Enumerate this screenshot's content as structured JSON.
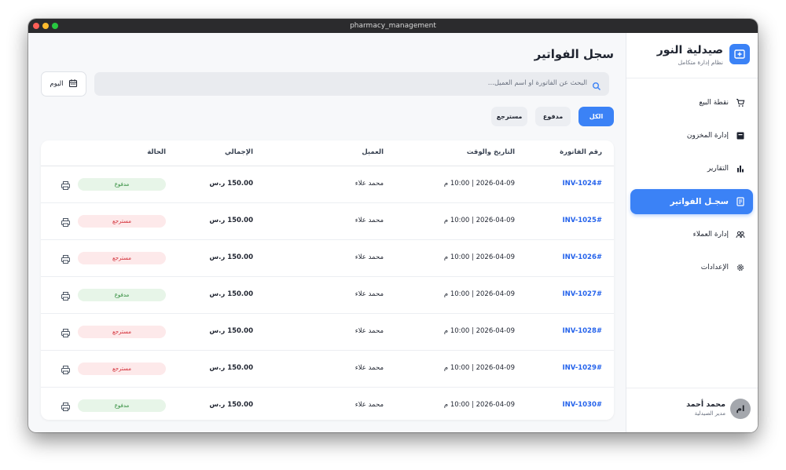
{
  "window": {
    "title": "pharmacy_management"
  },
  "brand": {
    "name": "صيدلية النور",
    "subtitle": "نظام إدارة متكامل"
  },
  "nav": [
    {
      "label": "نقطة البيع",
      "icon": "cart-icon"
    },
    {
      "label": "إدارة المخزون",
      "icon": "box-icon"
    },
    {
      "label": "التقارير",
      "icon": "bar-chart-icon"
    },
    {
      "label": "سجـل الفواتير",
      "icon": "receipt-icon",
      "active": true
    },
    {
      "label": "إدارة العملاء",
      "icon": "users-icon"
    },
    {
      "label": "الإعدادات",
      "icon": "gear-icon"
    }
  ],
  "user": {
    "initials": "ام",
    "name": "محمد أحمد",
    "role": "مدير الصيدلية"
  },
  "page": {
    "title": "سجل الفواتير"
  },
  "search": {
    "placeholder": "البحث عن الفاتورة او اسم العميل..."
  },
  "date_button": {
    "label": "اليوم"
  },
  "filters": [
    {
      "label": "الكل",
      "active": true
    },
    {
      "label": "مدفوع"
    },
    {
      "label": "مسترجع"
    }
  ],
  "table": {
    "headers": {
      "invoice": "رقم الفاتورة",
      "datetime": "التاريخ والوقت",
      "customer": "العميل",
      "total": "الإجمالي",
      "status": "الحالة"
    },
    "rows": [
      {
        "invoice": "INV-1024#",
        "datetime": "2026-04-09 | 10:00 م",
        "customer": "محمد علاء",
        "total": "150.00 ر.س",
        "status": "مدفوع",
        "status_type": "paid"
      },
      {
        "invoice": "INV-1025#",
        "datetime": "2026-04-09 | 10:00 م",
        "customer": "محمد علاء",
        "total": "150.00 ر.س",
        "status": "مسترجع",
        "status_type": "returned"
      },
      {
        "invoice": "INV-1026#",
        "datetime": "2026-04-09 | 10:00 م",
        "customer": "محمد علاء",
        "total": "150.00 ر.س",
        "status": "مسترجع",
        "status_type": "returned"
      },
      {
        "invoice": "INV-1027#",
        "datetime": "2026-04-09 | 10:00 م",
        "customer": "محمد علاء",
        "total": "150.00 ر.س",
        "status": "مدفوع",
        "status_type": "paid"
      },
      {
        "invoice": "INV-1028#",
        "datetime": "2026-04-09 | 10:00 م",
        "customer": "محمد علاء",
        "total": "150.00 ر.س",
        "status": "مسترجع",
        "status_type": "returned"
      },
      {
        "invoice": "INV-1029#",
        "datetime": "2026-04-09 | 10:00 م",
        "customer": "محمد علاء",
        "total": "150.00 ر.س",
        "status": "مسترجع",
        "status_type": "returned"
      },
      {
        "invoice": "INV-1030#",
        "datetime": "2026-04-09 | 10:00 م",
        "customer": "محمد علاء",
        "total": "150.00 ر.س",
        "status": "مدفوع",
        "status_type": "paid"
      }
    ]
  },
  "colors": {
    "accent": "#3b82f6",
    "invoice_link": "#2563eb",
    "paid_text": "#2e8b3a",
    "paid_bg": "#e7f5e8",
    "returned_text": "#d22a33",
    "returned_bg": "#fde9ea"
  }
}
